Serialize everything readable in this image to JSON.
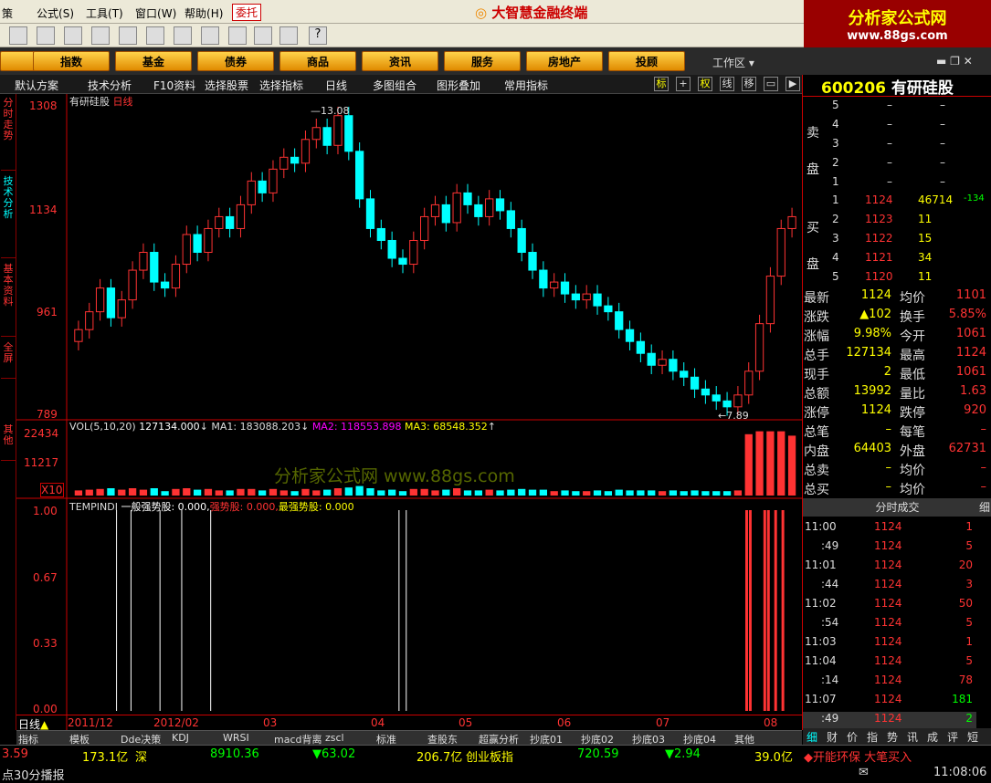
{
  "menu": {
    "items": [
      "策",
      "公式",
      "工具",
      "窗口",
      "帮助"
    ],
    "item_keys": [
      "",
      "(S)",
      "(T)",
      "(W)",
      "(H)"
    ],
    "active": "委托",
    "app_title": "大智慧金融终端"
  },
  "logo": {
    "cn": "分析家公式网",
    "url": "www.88gs.com"
  },
  "nav": {
    "buttons": [
      "指数",
      "基金",
      "债券",
      "商品",
      "资讯",
      "服务",
      "房地产",
      "投顾"
    ],
    "workspace": "工作区"
  },
  "subtool": {
    "items": [
      "默认方案",
      "技术分析",
      "F10资料",
      "选择股票",
      "选择指标",
      "日线",
      "多图组合",
      "图形叠加",
      "常用指标"
    ],
    "toggles": [
      "标",
      "权",
      "线",
      "移"
    ]
  },
  "left_tabs": [
    "分时走势",
    "技术分析",
    "基本资料",
    "全屏",
    "其他"
  ],
  "chart": {
    "name": "有研硅股",
    "period": "日线",
    "price_labels": [
      "1308",
      "1134",
      "961",
      "789"
    ],
    "high_mark": "13.08",
    "low_mark": "7.89",
    "vol_title": "VOL(5,10,20)",
    "vol_value": "127134.000",
    "ma1": "MA1: 183088.203",
    "ma2": "MA2: 118553.898",
    "ma3": "MA3: 68548.352",
    "vol_labels": [
      "22434",
      "11217",
      "X10"
    ],
    "ind_title": "TEMPINDI",
    "ind_a": "一般强势股: 0.000,",
    "ind_b": "强势股: 0.000,",
    "ind_c": "最强势股: 0.000",
    "ind_labels": [
      "1.00",
      "0.67",
      "0.33",
      "0.00"
    ],
    "dates": [
      "2011/12",
      "2012/02",
      "03",
      "04",
      "05",
      "06",
      "07",
      "08"
    ],
    "watermark": "分析家公式网 www.88gs.com",
    "period_label": "日线"
  },
  "chart_data": {
    "type": "candlestick",
    "y_range": [
      7.89,
      13.08
    ],
    "closes": [
      9.3,
      9.6,
      10.0,
      9.5,
      9.8,
      10.3,
      10.6,
      10.1,
      10.0,
      10.4,
      10.9,
      10.6,
      11.0,
      11.2,
      11.0,
      11.4,
      11.8,
      11.6,
      12.0,
      12.2,
      12.1,
      12.5,
      12.7,
      12.4,
      12.9,
      12.3,
      11.5,
      11.0,
      10.8,
      10.5,
      10.4,
      10.8,
      11.2,
      11.4,
      11.1,
      11.6,
      11.4,
      11.2,
      11.5,
      11.3,
      11.0,
      10.6,
      10.3,
      10.0,
      10.1,
      9.9,
      9.8,
      9.9,
      9.7,
      9.6,
      9.3,
      9.1,
      8.9,
      8.7,
      8.8,
      8.6,
      8.5,
      8.3,
      8.2,
      8.1,
      8.0,
      8.2,
      8.6,
      9.4,
      10.2,
      11.0,
      11.2
    ],
    "signals_white": [
      0.06,
      0.08,
      0.12,
      0.15,
      0.19,
      0.45,
      0.46
    ],
    "signals_red": [
      0.93,
      0.935,
      0.955,
      0.96,
      0.97,
      0.98
    ]
  },
  "quote": {
    "code": "600206",
    "name": "有研硅股",
    "sell_label": "卖盘",
    "buy_label": "买盘",
    "sell": [
      {
        "n": "5",
        "p": "–",
        "v": "–"
      },
      {
        "n": "4",
        "p": "–",
        "v": "–"
      },
      {
        "n": "3",
        "p": "–",
        "v": "–"
      },
      {
        "n": "2",
        "p": "–",
        "v": "–"
      },
      {
        "n": "1",
        "p": "–",
        "v": "–"
      }
    ],
    "buy": [
      {
        "n": "1",
        "p": "1124",
        "v": "46714",
        "x": "-134"
      },
      {
        "n": "2",
        "p": "1123",
        "v": "11",
        "x": ""
      },
      {
        "n": "3",
        "p": "1122",
        "v": "15",
        "x": ""
      },
      {
        "n": "4",
        "p": "1121",
        "v": "34",
        "x": ""
      },
      {
        "n": "5",
        "p": "1120",
        "v": "11",
        "x": ""
      }
    ],
    "fields": [
      [
        "最新",
        "1124",
        "均价",
        "1101"
      ],
      [
        "涨跌",
        "▲102",
        "换手",
        "5.85%"
      ],
      [
        "涨幅",
        "9.98%",
        "今开",
        "1061"
      ],
      [
        "总手",
        "127134",
        "最高",
        "1124"
      ],
      [
        "现手",
        "2",
        "最低",
        "1061"
      ],
      [
        "总额",
        "13992",
        "量比",
        "1.63"
      ],
      [
        "涨停",
        "1124",
        "跌停",
        "920"
      ],
      [
        "总笔",
        "–",
        "每笔",
        "–"
      ],
      [
        "内盘",
        "64403",
        "外盘",
        "62731"
      ],
      [
        "总卖",
        "–",
        "均价",
        "–"
      ],
      [
        "总买",
        "–",
        "均价",
        "–"
      ]
    ],
    "ticks_title": "分时成交",
    "ticks_btn": "细",
    "ticks": [
      [
        "11:00",
        "1124",
        "1"
      ],
      [
        ":49",
        "1124",
        "5"
      ],
      [
        "11:01",
        "1124",
        "20"
      ],
      [
        ":44",
        "1124",
        "3"
      ],
      [
        "11:02",
        "1124",
        "50"
      ],
      [
        ":54",
        "1124",
        "5"
      ],
      [
        "11:03",
        "1124",
        "1"
      ],
      [
        "11:04",
        "1124",
        "5"
      ],
      [
        ":14",
        "1124",
        "78"
      ],
      [
        "11:07",
        "1124",
        "181"
      ],
      [
        ":49",
        "1124",
        "2"
      ]
    ],
    "bottom_tabs": [
      "细",
      "财",
      "价",
      "指",
      "势",
      "讯",
      "成",
      "评",
      "短"
    ]
  },
  "bottom_tabs": [
    "指标",
    "模板",
    "Dde决策",
    "KDJ",
    "WRSI",
    "macd背离",
    "zscl",
    "标准",
    "查股东",
    "超赢分析",
    "抄底01",
    "抄底02",
    "抄底03",
    "抄底04",
    "其他"
  ],
  "status": {
    "a": "3.59",
    "b": "173.1亿",
    "c": "深",
    "d": "8910.36",
    "e": "▼63.02",
    "f": "206.7亿",
    "g": "创业板指",
    "h": "720.59",
    "i": "▼2.94",
    "j": "39.0亿",
    "k": "◆开能环保 大笔买入",
    "broadcast": "点30分播报",
    "time": "11:08:06"
  }
}
